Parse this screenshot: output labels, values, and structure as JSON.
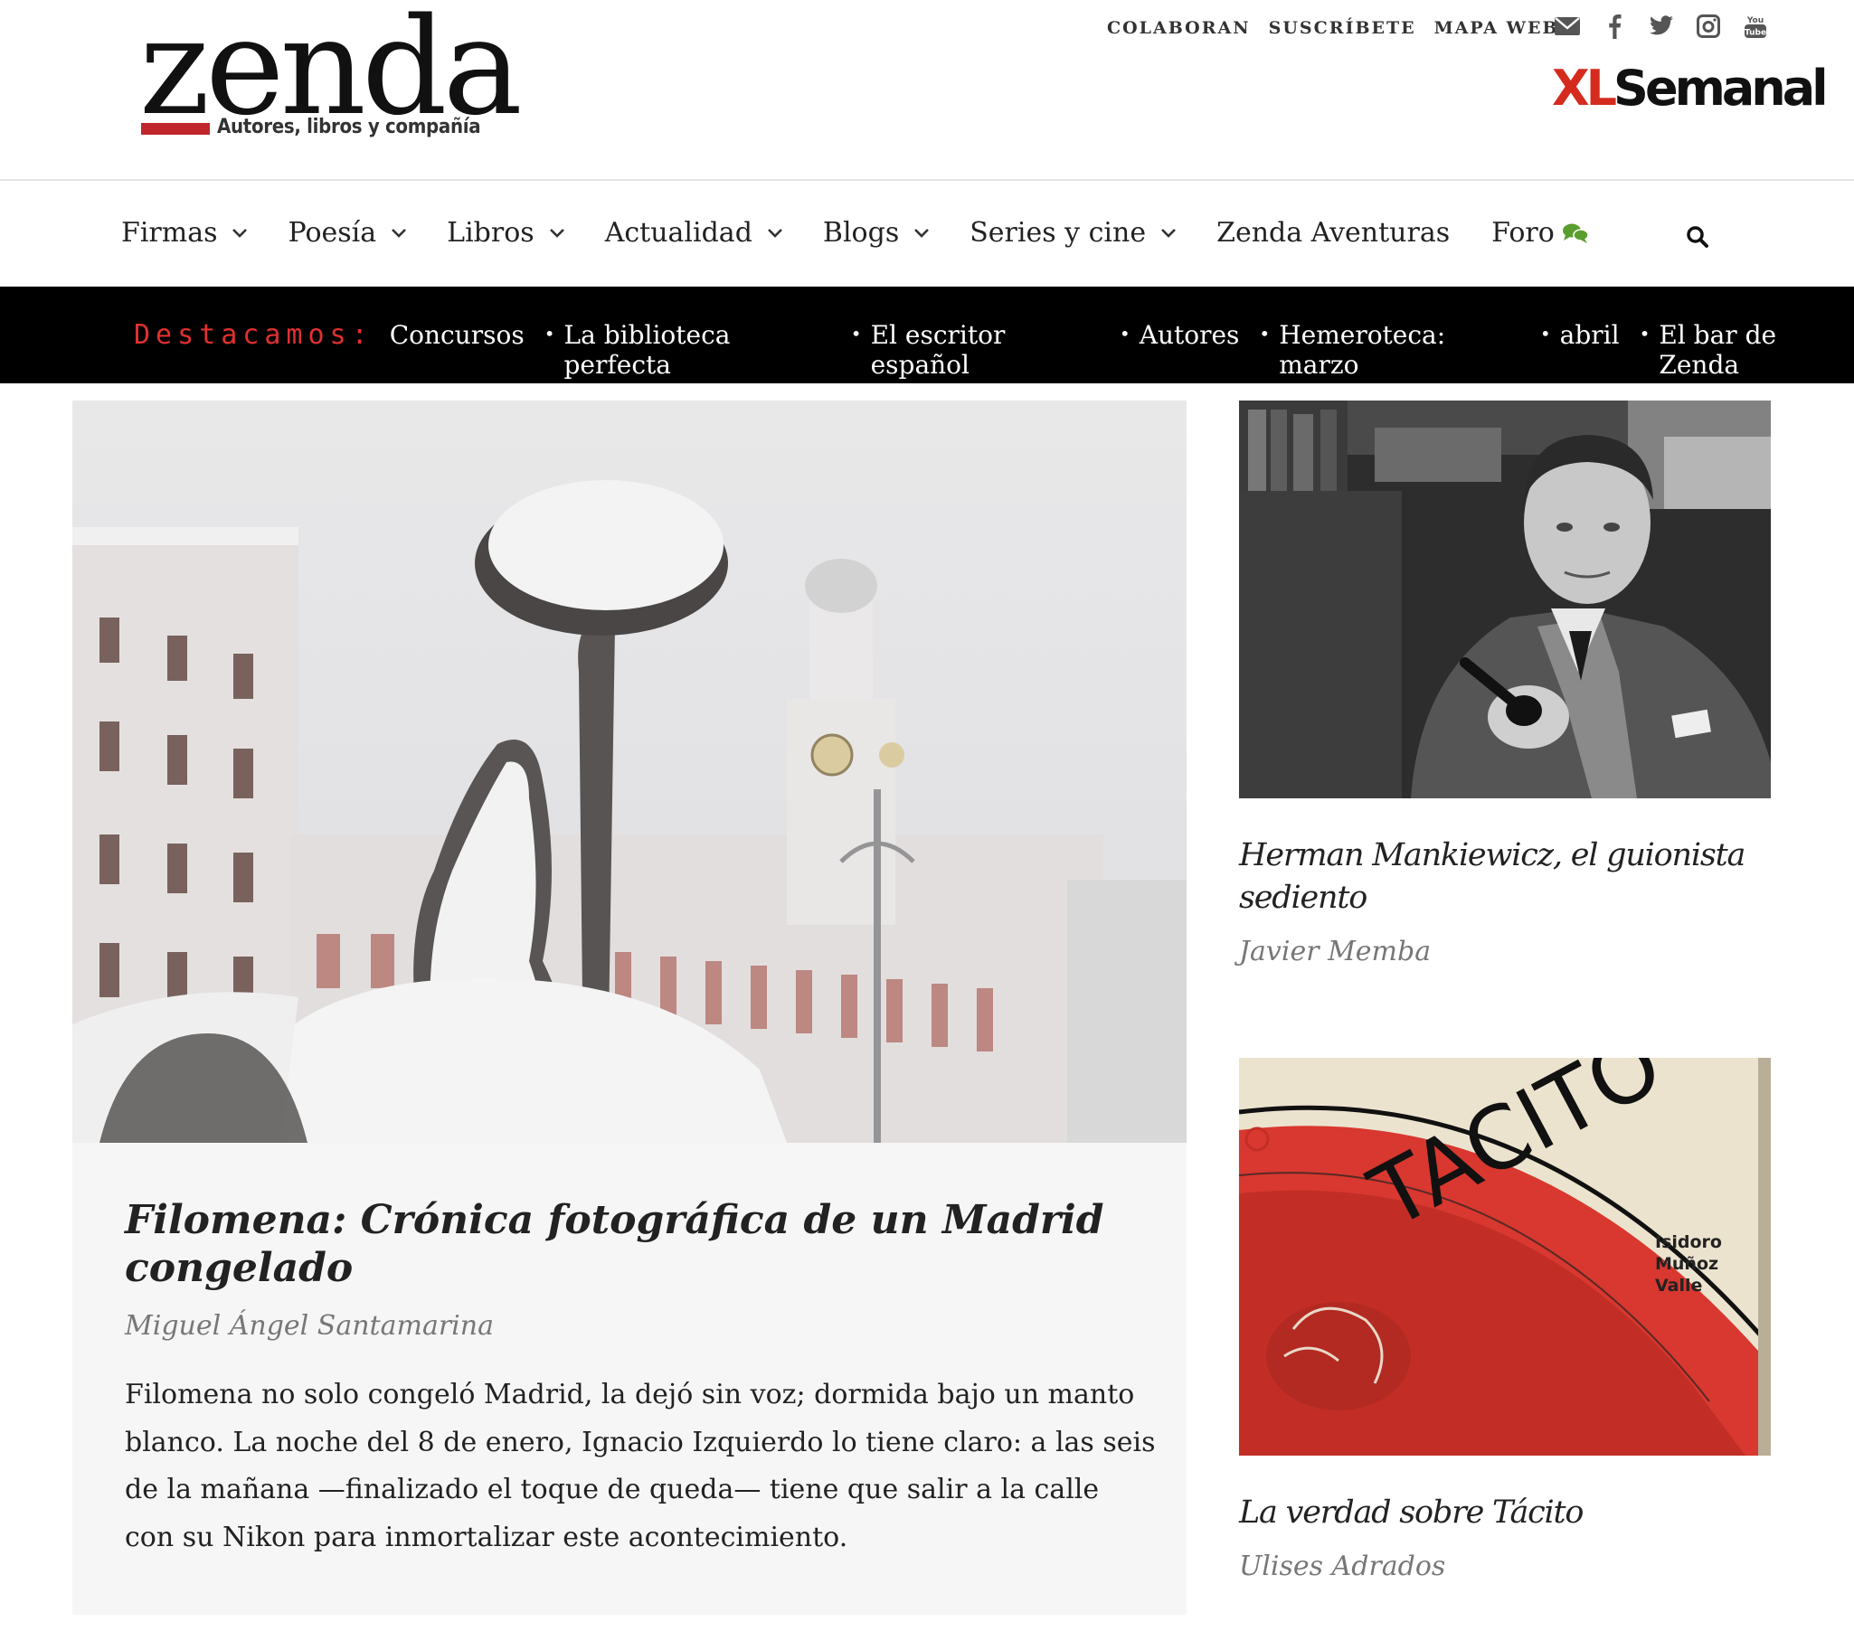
{
  "header": {
    "logo_word": "zenda",
    "logo_tagline": "Autores, libros y compañía",
    "top_links": [
      "COLABORAN",
      "SUSCRÍBETE",
      "MAPA WEB"
    ],
    "social": [
      "mail-icon",
      "facebook-icon",
      "twitter-icon",
      "instagram-icon",
      "youtube-icon"
    ],
    "partner_x": "XL",
    "partner_rest": "Semanal"
  },
  "nav": {
    "items": [
      {
        "label": "Firmas",
        "dropdown": true
      },
      {
        "label": "Poesía",
        "dropdown": true
      },
      {
        "label": "Libros",
        "dropdown": true
      },
      {
        "label": "Actualidad",
        "dropdown": true
      },
      {
        "label": "Blogs",
        "dropdown": true
      },
      {
        "label": "Series y cine",
        "dropdown": true
      },
      {
        "label": "Zenda Aventuras",
        "dropdown": false
      },
      {
        "label": "Foro",
        "dropdown": false,
        "icon": "chat-bubbles-icon"
      }
    ]
  },
  "highlights": {
    "label": "Destacamos:",
    "links": [
      "Concursos",
      "La biblioteca perfecta",
      "El escritor español",
      "Autores",
      "Hemeroteca: marzo",
      "abril",
      "El bar de Zenda"
    ]
  },
  "main_article": {
    "title": "Filomena: Crónica fotográfica de un Madrid congelado",
    "author": "Miguel Ángel Santamarina",
    "excerpt": "Filomena no solo congeló Madrid, la dejó sin voz; dormida bajo un manto blanco. La noche del 8 de enero, Ignacio Izquierdo lo tiene claro: a las seis de la mañana —finalizado el toque de queda— tiene que salir a la calle con su Nikon para inmortalizar este acontecimiento."
  },
  "side_articles": [
    {
      "title": "Herman Mankiewicz, el guionista sediento",
      "author": "Javier Memba"
    },
    {
      "title": "La verdad sobre Tácito",
      "author": "Ulises Adrados",
      "cover_title": "TACITO",
      "cover_author": [
        "Isidoro",
        "Muñoz",
        "Valle"
      ]
    }
  ],
  "colors": {
    "accent_red": "#c0272d",
    "highlight_label": "#e03030",
    "foro_icon": "#5a9e2f",
    "highlight_bar": "#000000",
    "card_bg": "#f6f6f6",
    "muted_text": "#777777"
  }
}
